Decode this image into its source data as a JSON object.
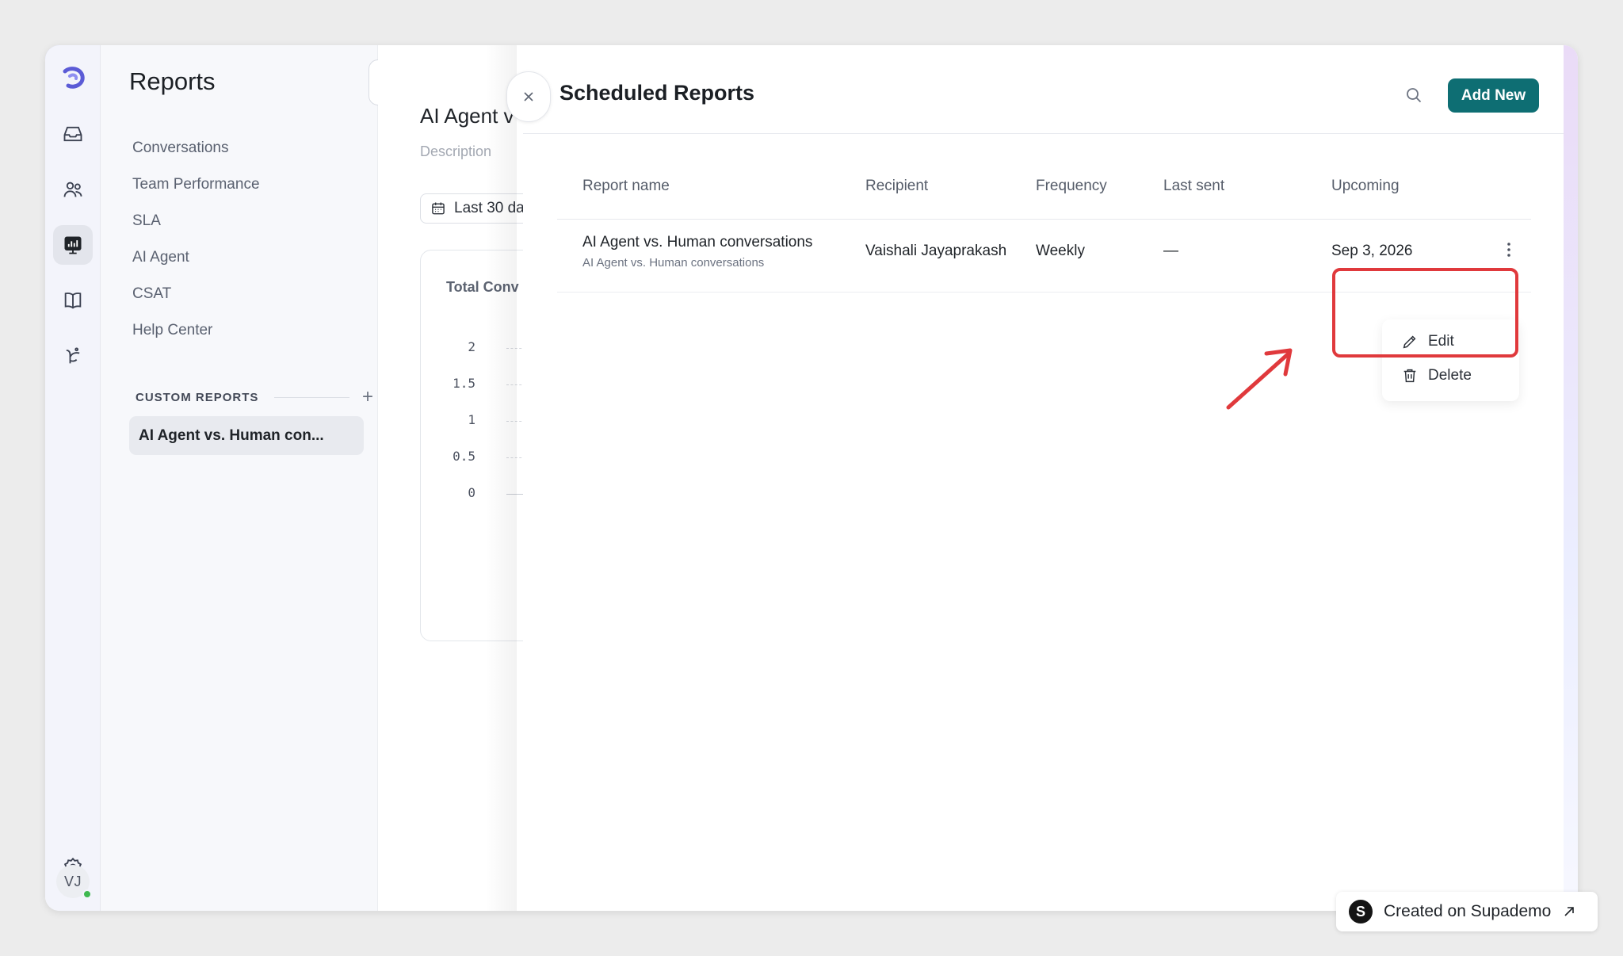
{
  "sidebar": {
    "title": "Reports",
    "nav": [
      "Conversations",
      "Team Performance",
      "SLA",
      "AI Agent",
      "CSAT",
      "Help Center"
    ],
    "custom_reports_label": "CUSTOM REPORTS",
    "custom_reports": [
      "AI Agent vs. Human con..."
    ]
  },
  "rail": {
    "avatar_initials": "VJ",
    "icons": [
      "brand-logo-icon",
      "inbox-icon",
      "contacts-icon",
      "reports-icon",
      "knowledge-base-icon",
      "ai-agent-icon",
      "settings-icon"
    ]
  },
  "report": {
    "title": "AI Agent v",
    "description": "Description",
    "date_range": "Last 30 da",
    "card_title": "Total Conv",
    "y_ticks": [
      "2",
      "1.5",
      "1",
      "0.5",
      "0"
    ]
  },
  "panel": {
    "title": "Scheduled Reports",
    "add_button": "Add New",
    "columns": [
      "Report name",
      "Recipient",
      "Frequency",
      "Last sent",
      "Upcoming"
    ],
    "rows": [
      {
        "name": "AI Agent vs. Human conversations",
        "subtitle": "AI Agent vs. Human conversations",
        "recipient": "Vaishali Jayaprakash",
        "frequency": "Weekly",
        "last_sent": "—",
        "upcoming": "Sep 3, 2026"
      }
    ],
    "menu": {
      "edit": "Edit",
      "delete": "Delete"
    }
  },
  "badge": {
    "text": "Created on Supademo",
    "logo_letter": "S"
  },
  "colors": {
    "accent": "#0e6e73",
    "highlight": "#e0393c"
  }
}
